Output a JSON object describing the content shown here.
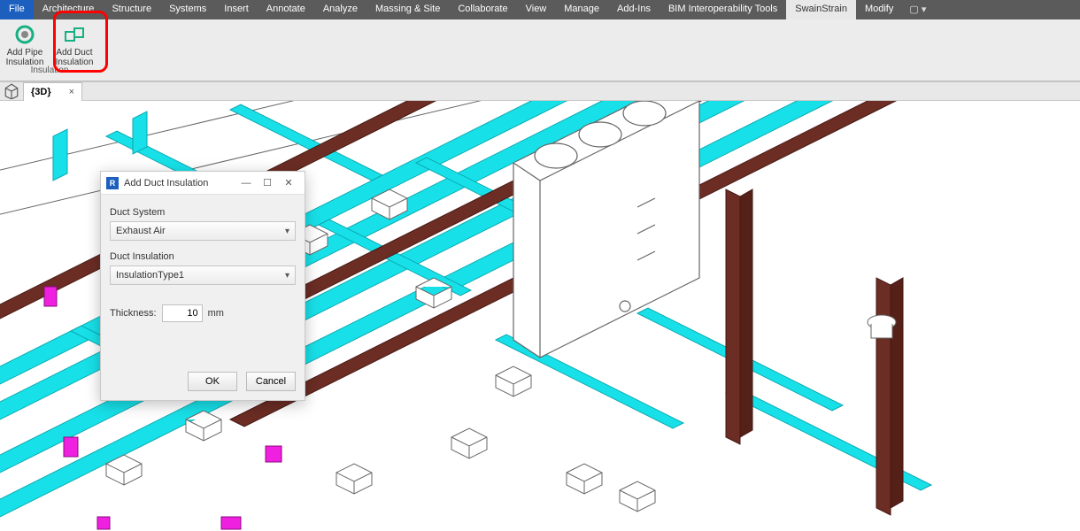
{
  "menu": {
    "items": [
      {
        "label": "File",
        "kind": "file"
      },
      {
        "label": "Architecture"
      },
      {
        "label": "Structure"
      },
      {
        "label": "Systems"
      },
      {
        "label": "Insert"
      },
      {
        "label": "Annotate"
      },
      {
        "label": "Analyze"
      },
      {
        "label": "Massing & Site"
      },
      {
        "label": "Collaborate"
      },
      {
        "label": "View"
      },
      {
        "label": "Manage"
      },
      {
        "label": "Add-Ins"
      },
      {
        "label": "BIM Interoperability Tools"
      },
      {
        "label": "SwainStrain",
        "kind": "active"
      },
      {
        "label": "Modify"
      }
    ],
    "qat": "▢ ▾"
  },
  "ribbon": {
    "panel_label": "Insulation",
    "buttons": [
      {
        "line1": "Add Pipe",
        "line2": "Insulation",
        "icon": "pipe-insulation"
      },
      {
        "line1": "Add Duct",
        "line2": "Insulation",
        "icon": "duct-insulation"
      }
    ]
  },
  "viewtab": {
    "label": "{3D}",
    "close": "×"
  },
  "dialog": {
    "title": "Add Duct Insulation",
    "minimize": "—",
    "maximize": "☐",
    "close": "✕",
    "duct_system_label": "Duct System",
    "duct_system_value": "Exhaust Air",
    "duct_insulation_label": "Duct Insulation",
    "duct_insulation_value": "InsulationType1",
    "thickness_label": "Thickness:",
    "thickness_value": "10",
    "thickness_unit": "mm",
    "ok": "OK",
    "cancel": "Cancel"
  },
  "colors": {
    "cyan": "#18e0e8",
    "brown": "#6b2d24",
    "magenta": "#f020e0",
    "outline": "#666"
  }
}
